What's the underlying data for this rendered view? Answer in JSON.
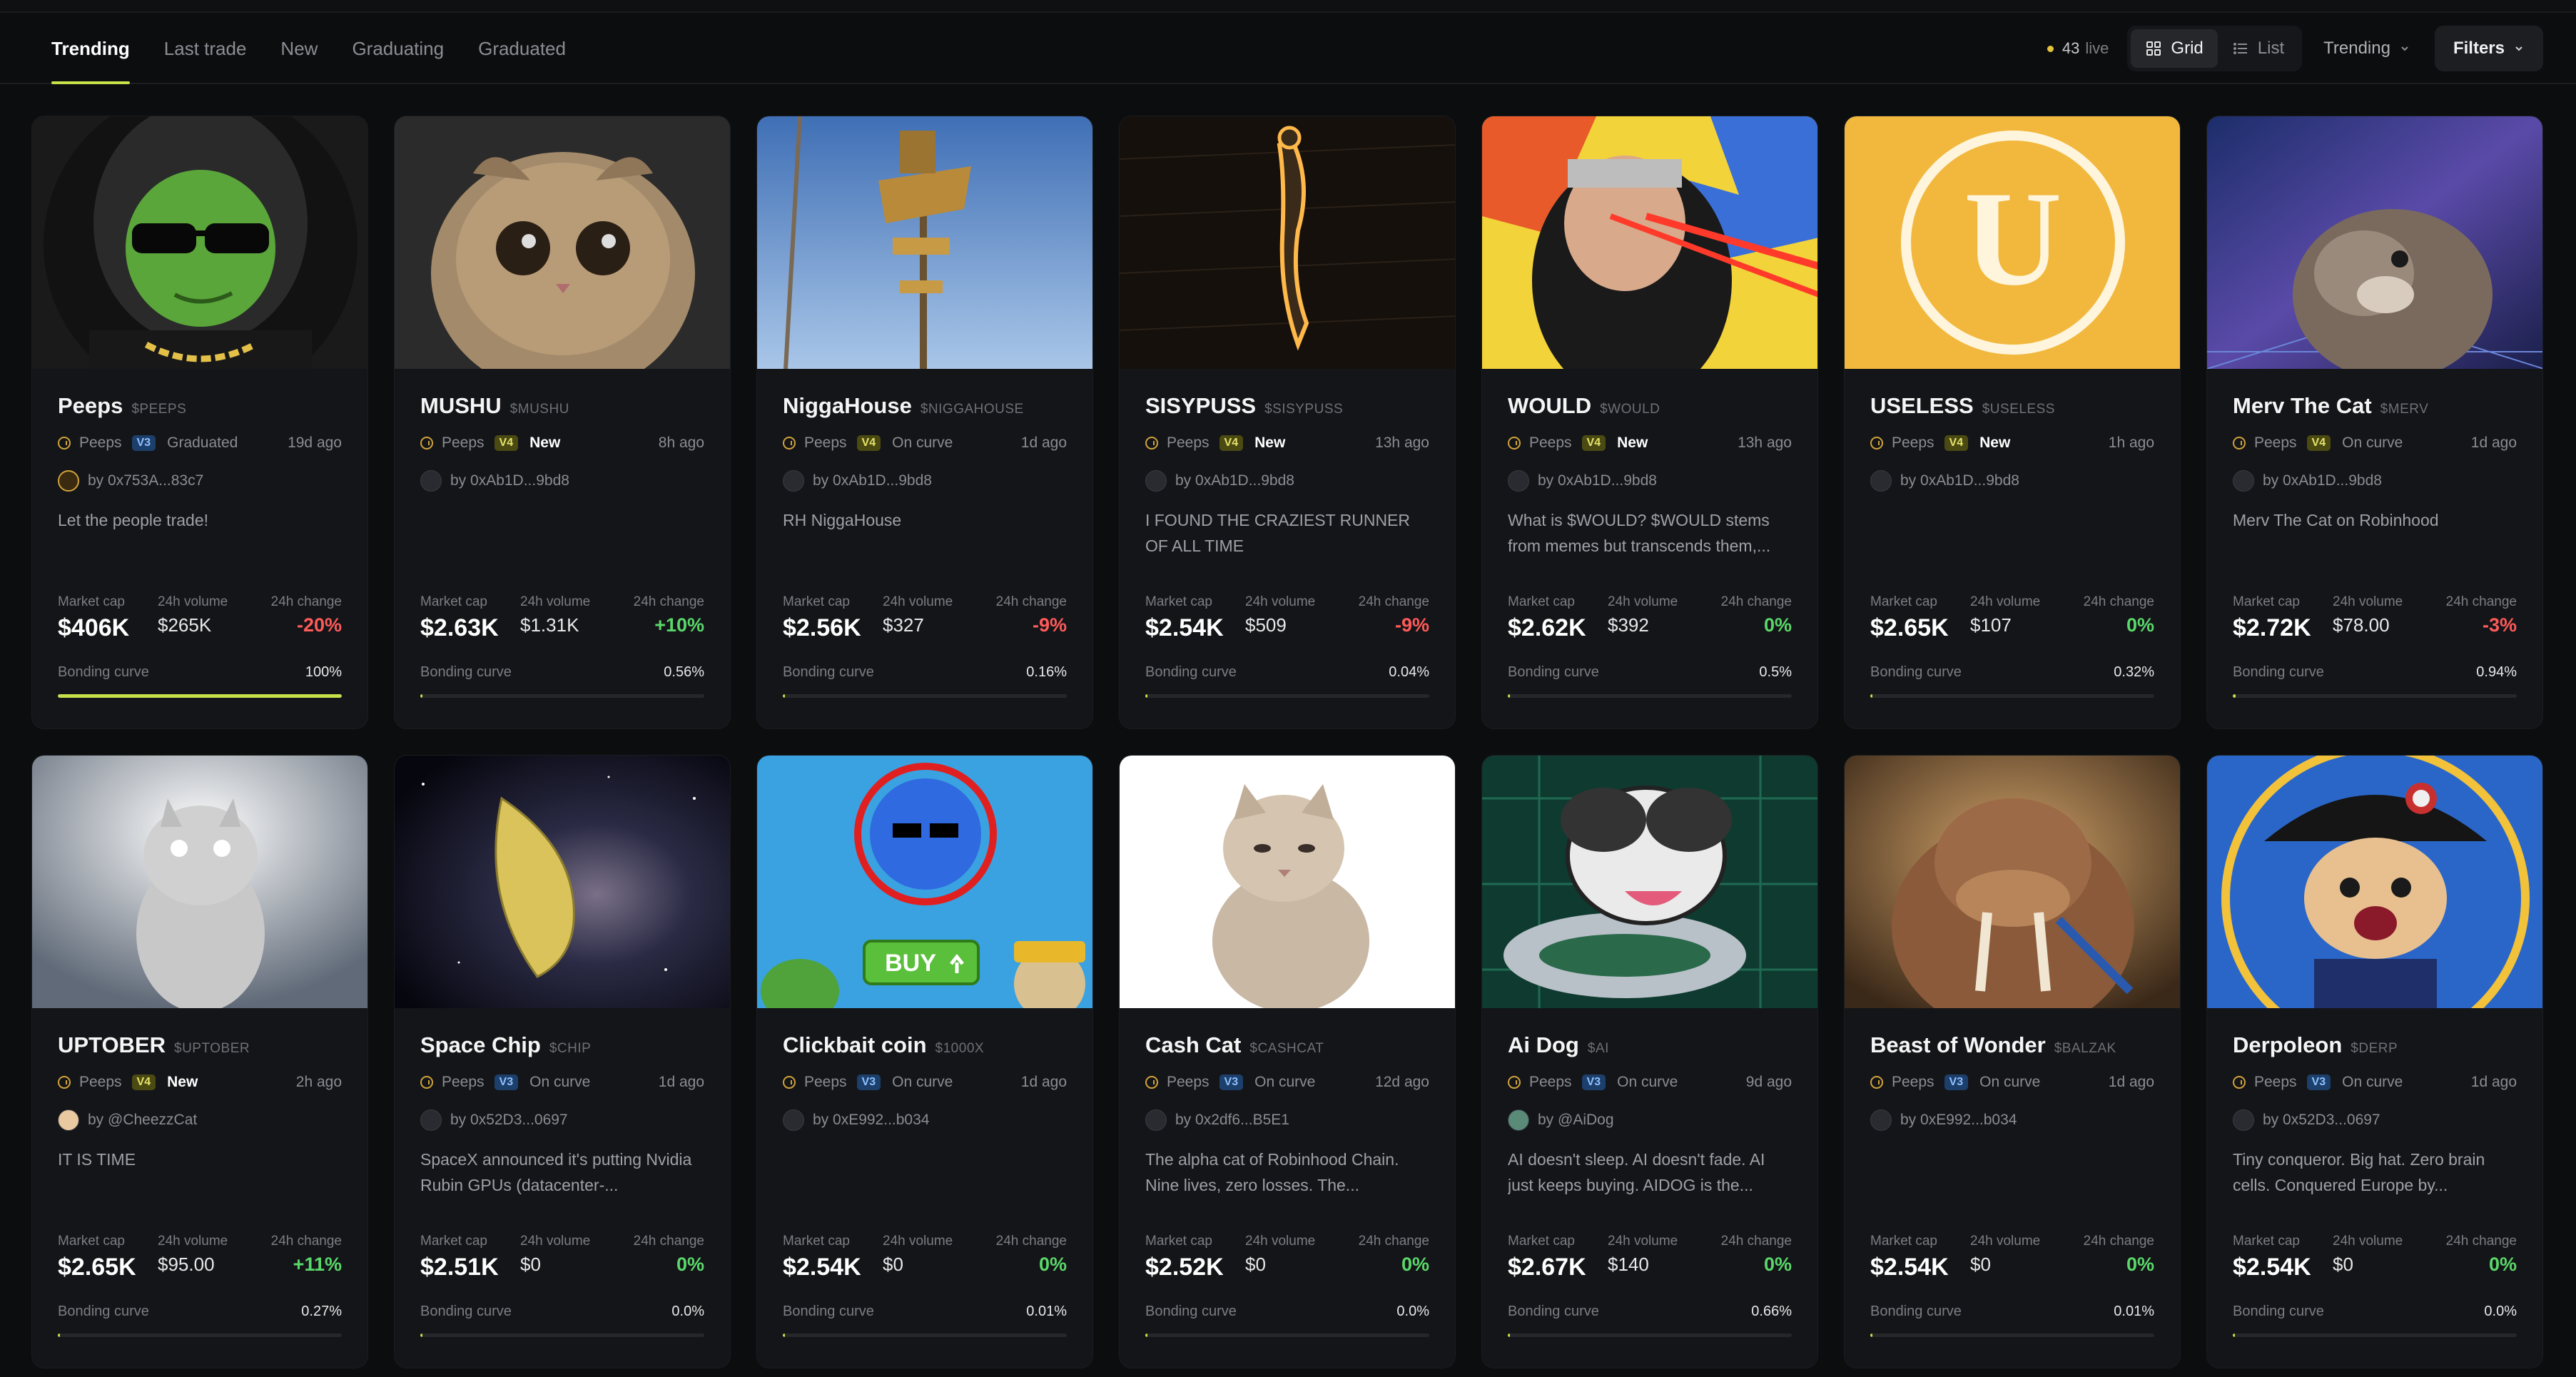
{
  "nav": {
    "tabs": [
      "Trending",
      "Last trade",
      "New",
      "Graduating",
      "Graduated"
    ],
    "active_tab": "Trending",
    "live_count": "43",
    "live_label": "live",
    "view_grid": "Grid",
    "view_list": "List",
    "sort": "Trending",
    "filters": "Filters"
  },
  "labels": {
    "market_cap": "Market cap",
    "volume": "24h volume",
    "change": "24h change",
    "bonding": "Bonding curve"
  },
  "accent": "#c6e24a",
  "cards": [
    {
      "name": "Peeps",
      "ticker": "$PEEPS",
      "platform": "Peeps",
      "version": "V3",
      "status": "Graduated",
      "ago": "19d ago",
      "by": "by 0x753A...83c7",
      "desc": "Let the people trade!",
      "mcap": "$406K",
      "vol": "$265K",
      "chg": "-20%",
      "dir": "down",
      "bc": "100%",
      "bc_pct": 100,
      "art": "peeps"
    },
    {
      "name": "MUSHU",
      "ticker": "$MUSHU",
      "platform": "Peeps",
      "version": "V4",
      "status": "New",
      "ago": "8h ago",
      "by": "by 0xAb1D...9bd8",
      "desc": "",
      "mcap": "$2.63K",
      "vol": "$1.31K",
      "chg": "+10%",
      "dir": "up",
      "bc": "0.56%",
      "bc_pct": 0.56,
      "art": "mushu"
    },
    {
      "name": "NiggaHouse",
      "ticker": "$NIGGAHOUSE",
      "platform": "Peeps",
      "version": "V4",
      "status": "On curve",
      "ago": "1d ago",
      "by": "by 0xAb1D...9bd8",
      "desc": "RH NiggaHouse",
      "mcap": "$2.56K",
      "vol": "$327",
      "chg": "-9%",
      "dir": "down",
      "bc": "0.16%",
      "bc_pct": 0.16,
      "art": "house"
    },
    {
      "name": "SISYPUSS",
      "ticker": "$SISYPUSS",
      "platform": "Peeps",
      "version": "V4",
      "status": "New",
      "ago": "13h ago",
      "by": "by 0xAb1D...9bd8",
      "desc": "I FOUND THE CRAZIEST RUNNER OF ALL TIME",
      "mcap": "$2.54K",
      "vol": "$509",
      "chg": "-9%",
      "dir": "down",
      "bc": "0.04%",
      "bc_pct": 0.04,
      "art": "sisy"
    },
    {
      "name": "WOULD",
      "ticker": "$WOULD",
      "platform": "Peeps",
      "version": "V4",
      "status": "New",
      "ago": "13h ago",
      "by": "by 0xAb1D...9bd8",
      "desc": "What is $WOULD? $WOULD stems from memes but transcends them,...",
      "mcap": "$2.62K",
      "vol": "$392",
      "chg": "0%",
      "dir": "zero",
      "bc": "0.5%",
      "bc_pct": 0.5,
      "art": "would"
    },
    {
      "name": "USELESS",
      "ticker": "$USELESS",
      "platform": "Peeps",
      "version": "V4",
      "status": "New",
      "ago": "1h ago",
      "by": "by 0xAb1D...9bd8",
      "desc": "",
      "mcap": "$2.65K",
      "vol": "$107",
      "chg": "0%",
      "dir": "zero",
      "bc": "0.32%",
      "bc_pct": 0.32,
      "art": "useless"
    },
    {
      "name": "Merv The Cat",
      "ticker": "$MERV",
      "platform": "Peeps",
      "version": "V4",
      "status": "On curve",
      "ago": "1d ago",
      "by": "by 0xAb1D...9bd8",
      "desc": "Merv The Cat on Robinhood",
      "mcap": "$2.72K",
      "vol": "$78.00",
      "chg": "-3%",
      "dir": "down",
      "bc": "0.94%",
      "bc_pct": 0.94,
      "art": "merv"
    },
    {
      "name": "UPTOBER",
      "ticker": "$UPTOBER",
      "platform": "Peeps",
      "version": "V4",
      "status": "New",
      "ago": "2h ago",
      "by": "by @CheezzCat",
      "desc": "IT IS TIME",
      "mcap": "$2.65K",
      "vol": "$95.00",
      "chg": "+11%",
      "dir": "up",
      "bc": "0.27%",
      "bc_pct": 0.27,
      "art": "uptober"
    },
    {
      "name": "Space Chip",
      "ticker": "$CHIP",
      "platform": "Peeps",
      "version": "V3",
      "status": "On curve",
      "ago": "1d ago",
      "by": "by 0x52D3...0697",
      "desc": "SpaceX announced it's putting Nvidia Rubin GPUs (datacenter-...",
      "mcap": "$2.51K",
      "vol": "$0",
      "chg": "0%",
      "dir": "zero",
      "bc": "0.0%",
      "bc_pct": 0,
      "art": "chip"
    },
    {
      "name": "Clickbait coin",
      "ticker": "$1000X",
      "platform": "Peeps",
      "version": "V3",
      "status": "On curve",
      "ago": "1d ago",
      "by": "by 0xE992...b034",
      "desc": "",
      "mcap": "$2.54K",
      "vol": "$0",
      "chg": "0%",
      "dir": "zero",
      "bc": "0.01%",
      "bc_pct": 0.01,
      "art": "click",
      "buy": "BUY"
    },
    {
      "name": "Cash Cat",
      "ticker": "$CASHCAT",
      "platform": "Peeps",
      "version": "V3",
      "status": "On curve",
      "ago": "12d ago",
      "by": "by 0x2df6...B5E1",
      "desc": "The alpha cat of Robinhood Chain. Nine lives, zero losses. The...",
      "mcap": "$2.52K",
      "vol": "$0",
      "chg": "0%",
      "dir": "zero",
      "bc": "0.0%",
      "bc_pct": 0,
      "art": "cashcat"
    },
    {
      "name": "Ai Dog",
      "ticker": "$AI",
      "platform": "Peeps",
      "version": "V3",
      "status": "On curve",
      "ago": "9d ago",
      "by": "by @AiDog",
      "desc": "AI doesn't sleep. AI doesn't fade. AI just keeps buying. AIDOG is the...",
      "mcap": "$2.67K",
      "vol": "$140",
      "chg": "0%",
      "dir": "zero",
      "bc": "0.66%",
      "bc_pct": 0.66,
      "art": "aidog"
    },
    {
      "name": "Beast of Wonder",
      "ticker": "$BALZAK",
      "platform": "Peeps",
      "version": "V3",
      "status": "On curve",
      "ago": "1d ago",
      "by": "by 0xE992...b034",
      "desc": "",
      "mcap": "$2.54K",
      "vol": "$0",
      "chg": "0%",
      "dir": "zero",
      "bc": "0.01%",
      "bc_pct": 0.01,
      "art": "walrus"
    },
    {
      "name": "Derpoleon",
      "ticker": "$DERP",
      "platform": "Peeps",
      "version": "V3",
      "status": "On curve",
      "ago": "1d ago",
      "by": "by 0x52D3...0697",
      "desc": "Tiny conqueror. Big hat. Zero brain cells. Conquered Europe by...",
      "mcap": "$2.54K",
      "vol": "$0",
      "chg": "0%",
      "dir": "zero",
      "bc": "0.0%",
      "bc_pct": 0,
      "art": "derp"
    }
  ]
}
